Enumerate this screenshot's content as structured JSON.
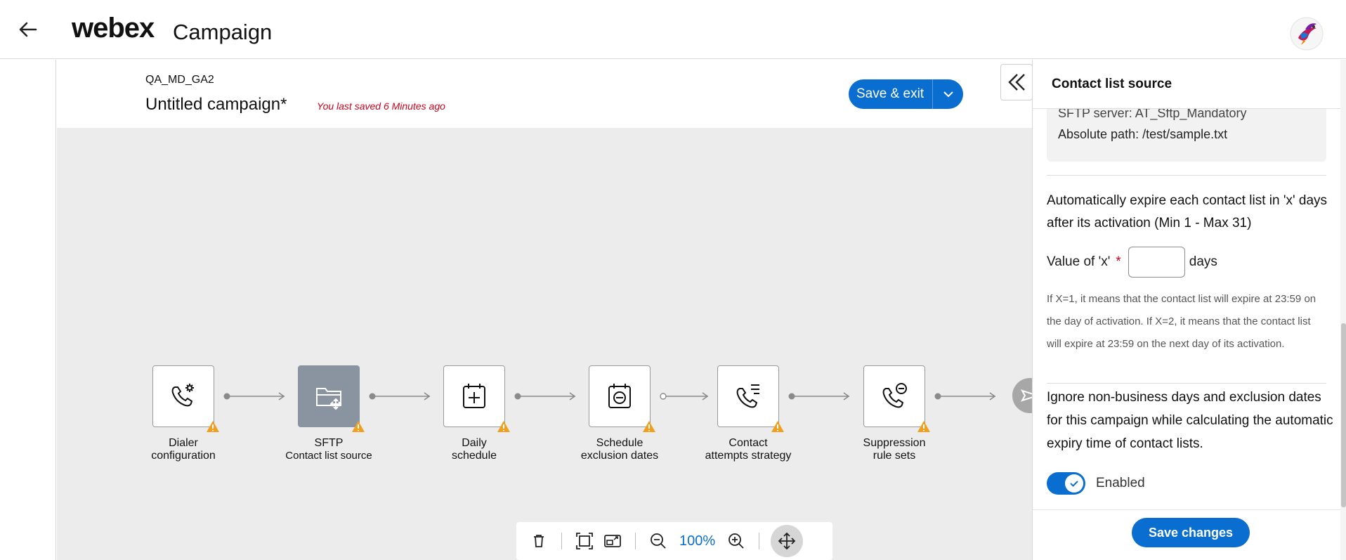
{
  "app": {
    "brand": "webex",
    "product": "Campaign"
  },
  "campaign": {
    "org": "QA_MD_GA2",
    "name": "Untitled campaign*",
    "saved_status": "You last saved 6 Minutes ago",
    "save_exit_label": "Save & exit"
  },
  "workflow": {
    "nodes": [
      {
        "line1": "Dialer",
        "line2": "configuration",
        "icon": "phone-gear-icon",
        "warning": true
      },
      {
        "line1": "SFTP",
        "line2": "Contact list source",
        "icon": "folder-move-icon",
        "warning": true,
        "selected": true
      },
      {
        "line1": "Daily",
        "line2": "schedule",
        "icon": "calendar-add-icon",
        "warning": true
      },
      {
        "line1": "Schedule",
        "line2": "exclusion dates",
        "icon": "calendar-minus-icon",
        "warning": true
      },
      {
        "line1": "Contact",
        "line2": "attempts strategy",
        "icon": "phone-list-icon",
        "warning": true
      },
      {
        "line1": "Suppression",
        "line2": "rule sets",
        "icon": "phone-block-icon",
        "warning": true
      }
    ]
  },
  "toolbar": {
    "zoom": "100%"
  },
  "panel": {
    "title": "Contact list source",
    "info_cut": "SFTP server: AT_Sftp_Mandatory",
    "absolute_path": "Absolute path: /test/sample.txt",
    "expire_text": "Automatically expire each contact list in 'x' days after its activation (Min 1 - Max 31)",
    "x_label": "Value of 'x'",
    "x_required": "*",
    "x_value": "",
    "x_unit": "days",
    "help_text": "If X=1, it means that the contact list will expire at 23:59 on the day of activation. If X=2, it means that the contact list will expire at 23:59 on the next day of its activation.",
    "ignore_text": "Ignore non-business days and exclusion dates for this campaign while calculating the automatic expiry time of contact lists.",
    "toggle_label": "Enabled",
    "toggle_on": true,
    "save_changes_label": "Save changes"
  },
  "colors": {
    "accent": "#0a6ed1",
    "warning": "#f0a01e",
    "error": "#d0021b",
    "canvas": "#ececec"
  }
}
